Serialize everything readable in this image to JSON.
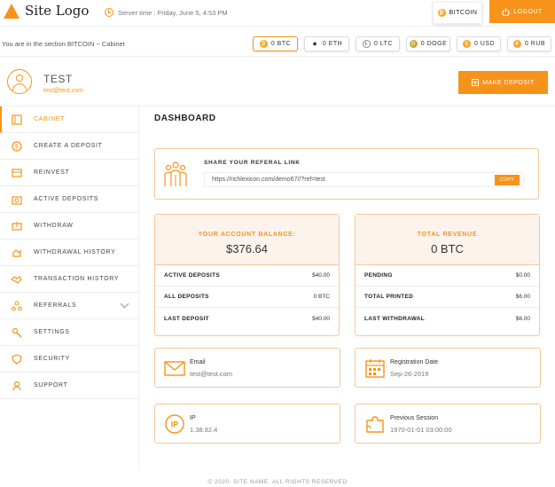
{
  "header": {
    "logo_text": "Site Logo",
    "server_time": "Server time : Friday, June 5, 4:53 PM",
    "currency_button": "BITCOIN",
    "logout_label": "LOGOUT"
  },
  "section": {
    "prefix": "You are in the section ",
    "name": "BITCOIN",
    "suffix": " ~ Cabinet"
  },
  "currencies": [
    {
      "label": "0 BTC",
      "icon": "bitcoin-icon",
      "active": true
    },
    {
      "label": "0 ETH",
      "icon": "ethereum-icon",
      "active": false
    },
    {
      "label": "0 LTC",
      "icon": "litecoin-icon",
      "active": false
    },
    {
      "label": "0 DOGE",
      "icon": "dogecoin-icon",
      "active": false
    },
    {
      "label": "0 USD",
      "icon": "dollar-icon",
      "active": false
    },
    {
      "label": "0 RUB",
      "icon": "ruble-icon",
      "active": false
    }
  ],
  "user": {
    "name": "TEST",
    "email": "test@test.com"
  },
  "make_deposit_label": "MAKE DEPOSIT",
  "nav": [
    {
      "label": "CABINET",
      "icon": "cabinet-icon"
    },
    {
      "label": "CREATE A DEPOSIT",
      "icon": "create-deposit-icon"
    },
    {
      "label": "REINVEST",
      "icon": "reinvest-icon"
    },
    {
      "label": "ACTIVE DEPOSITS",
      "icon": "active-deposits-icon"
    },
    {
      "label": "WITHDRAW",
      "icon": "withdraw-icon"
    },
    {
      "label": "WITHDRAWAL HISTORY",
      "icon": "withdrawal-history-icon"
    },
    {
      "label": "TRANSACTION HISTORY",
      "icon": "handshake-icon"
    },
    {
      "label": "REFERRALS",
      "icon": "referrals-icon"
    },
    {
      "label": "SETTINGS",
      "icon": "settings-icon"
    },
    {
      "label": "SECURITY",
      "icon": "shield-icon"
    },
    {
      "label": "SUPPORT",
      "icon": "support-icon"
    }
  ],
  "dashboard_title": "DASHBOARD",
  "referral": {
    "title": "SHARE YOUR REFERAL LINK",
    "link": "https://richlexicon.com/demo67//?ref=test",
    "copy_label": "COPY"
  },
  "balance": {
    "label": "YOUR ACCOUNT BALANCE:",
    "value": "$376.64",
    "rows": [
      {
        "k": "ACTIVE DEPOSITS",
        "v": "$40.00"
      },
      {
        "k": "ALL DEPOSITS",
        "v": "0 BTC"
      },
      {
        "k": "LAST DEPOSIT",
        "v": "$40.00"
      }
    ]
  },
  "revenue": {
    "label": "TOTAL REVENUE",
    "value": "0 BTC",
    "rows": [
      {
        "k": "PENDING",
        "v": "$0.00"
      },
      {
        "k": "TOTAL PRINTED",
        "v": "$6.00"
      },
      {
        "k": "LAST WITHDRAWAL",
        "v": "$6.00"
      }
    ]
  },
  "info": {
    "email_label": "Email",
    "email_value": "test@test.com",
    "reg_label": "Registration Date",
    "reg_value": "Sep-26-2019",
    "ip_label": "IP",
    "ip_value": "1.38.92.4",
    "session_label": "Previous Session",
    "session_value": "1970-01-01 03:00:00"
  },
  "footer": "© 2020. SITE NAME. ALL RIGHTS RESERVED",
  "colors": {
    "accent": "#f7931a"
  }
}
